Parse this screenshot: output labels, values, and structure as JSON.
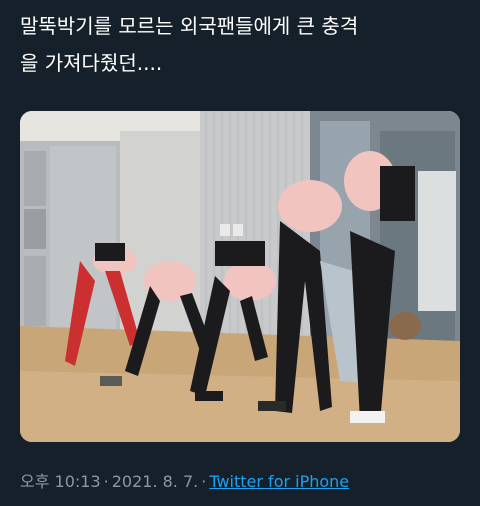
{
  "tweet": {
    "text_line1": "말뚝박기를 모르는 외국팬들에게 큰 충격",
    "text_line2": "을 가져다줬던....",
    "time": "오후 10:13",
    "separator": "·",
    "date": "2021. 8. 7.",
    "source": "Twitter for iPhone"
  },
  "media": {
    "type": "photo",
    "description_icon": "photo-icon"
  },
  "colors": {
    "background": "#15202b",
    "text": "#ffffff",
    "meta": "#8899a6",
    "link": "#1da1f2"
  }
}
